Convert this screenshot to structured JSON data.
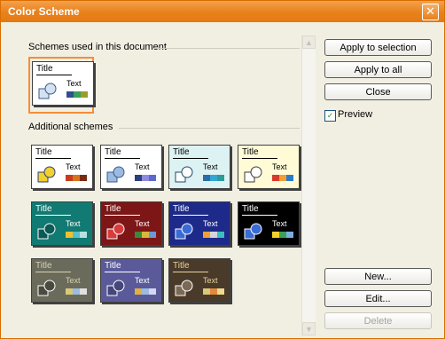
{
  "dialog": {
    "title": "Color Scheme",
    "close_glyph": "✕"
  },
  "sections": {
    "used": "Schemes used in this document",
    "additional": "Additional schemes"
  },
  "scheme_text": {
    "title": "Title",
    "text": "Text"
  },
  "buttons": {
    "apply_selection": "Apply to selection",
    "apply_all": "Apply to all",
    "close": "Close",
    "new": "New...",
    "edit": "Edit...",
    "delete": "Delete"
  },
  "preview": {
    "label": "Preview",
    "checked": true,
    "check_glyph": "✓"
  },
  "scrollbar": {
    "up_glyph": "▲",
    "down_glyph": "▼"
  },
  "colors": {
    "accent": "#e8811c",
    "selection": "#f58e3a"
  },
  "schemes_used": [
    {
      "bg": "#ffffff",
      "fg": "#000000",
      "shape1": "#d4e2f0",
      "shape2": "#3a5a8c",
      "bars": [
        "#2f4f8f",
        "#3aa05a",
        "#9c9c2c"
      ]
    }
  ],
  "schemes_additional": [
    {
      "bg": "#ffffff",
      "fg": "#000000",
      "shape1": "#f2d12c",
      "shape2": "#2b3f7a",
      "bars": [
        "#c83c1c",
        "#d8731c",
        "#7a2a10"
      ]
    },
    {
      "bg": "#ffffff",
      "fg": "#000000",
      "shape1": "#9bbbe0",
      "shape2": "#3a5a8c",
      "bars": [
        "#2b3f7a",
        "#8f8ae0",
        "#5a6ad0"
      ]
    },
    {
      "bg": "#ddf2f2",
      "fg": "#000000",
      "shape1": "#ffffff",
      "shape2": "#1a4a6a",
      "bars": [
        "#2b6ea5",
        "#33a5d6",
        "#2d9a9a"
      ]
    },
    {
      "bg": "#fffbd6",
      "fg": "#000000",
      "shape1": "#ffffff",
      "shape2": "#3a3a3a",
      "bars": [
        "#d83a2c",
        "#f0a030",
        "#2a7ad0"
      ]
    },
    {
      "bg": "#117a72",
      "fg": "#ffffff",
      "shape1": "#0a5a55",
      "shape2": "#ffffff",
      "bars": [
        "#f2c02a",
        "#5ac0c8",
        "#b8e0e0"
      ]
    },
    {
      "bg": "#7d1616",
      "fg": "#ffffff",
      "shape1": "#d63c3c",
      "shape2": "#ffffff",
      "bars": [
        "#3a8a3a",
        "#d6b83a",
        "#6a9ad6"
      ]
    },
    {
      "bg": "#1e2a8a",
      "fg": "#ffffff",
      "shape1": "#3a6ad6",
      "shape2": "#ffffff",
      "bars": [
        "#f0a030",
        "#d6d6d6",
        "#3ac0c0"
      ]
    },
    {
      "bg": "#000000",
      "fg": "#ffffff",
      "shape1": "#3a6ad6",
      "shape2": "#ffffff",
      "bars": [
        "#f2d12c",
        "#3aa05a",
        "#7ab0e0"
      ]
    },
    {
      "bg": "#6b6b5c",
      "fg": "#d8d2b0",
      "shape1": "#4a4a3e",
      "shape2": "#ffffff",
      "bars": [
        "#d8c87a",
        "#9bbbe0",
        "#e0e0e0"
      ]
    },
    {
      "bg": "#5a5a9a",
      "fg": "#ffffff",
      "shape1": "#46467a",
      "shape2": "#ffffff",
      "bars": [
        "#e0b040",
        "#9bbbe0",
        "#d6d6f0"
      ]
    },
    {
      "bg": "#4a3a2a",
      "fg": "#e8d49a",
      "shape1": "#7a6a55",
      "shape2": "#ffffff",
      "bars": [
        "#d8c87a",
        "#e08a3a",
        "#f0d890"
      ]
    }
  ]
}
